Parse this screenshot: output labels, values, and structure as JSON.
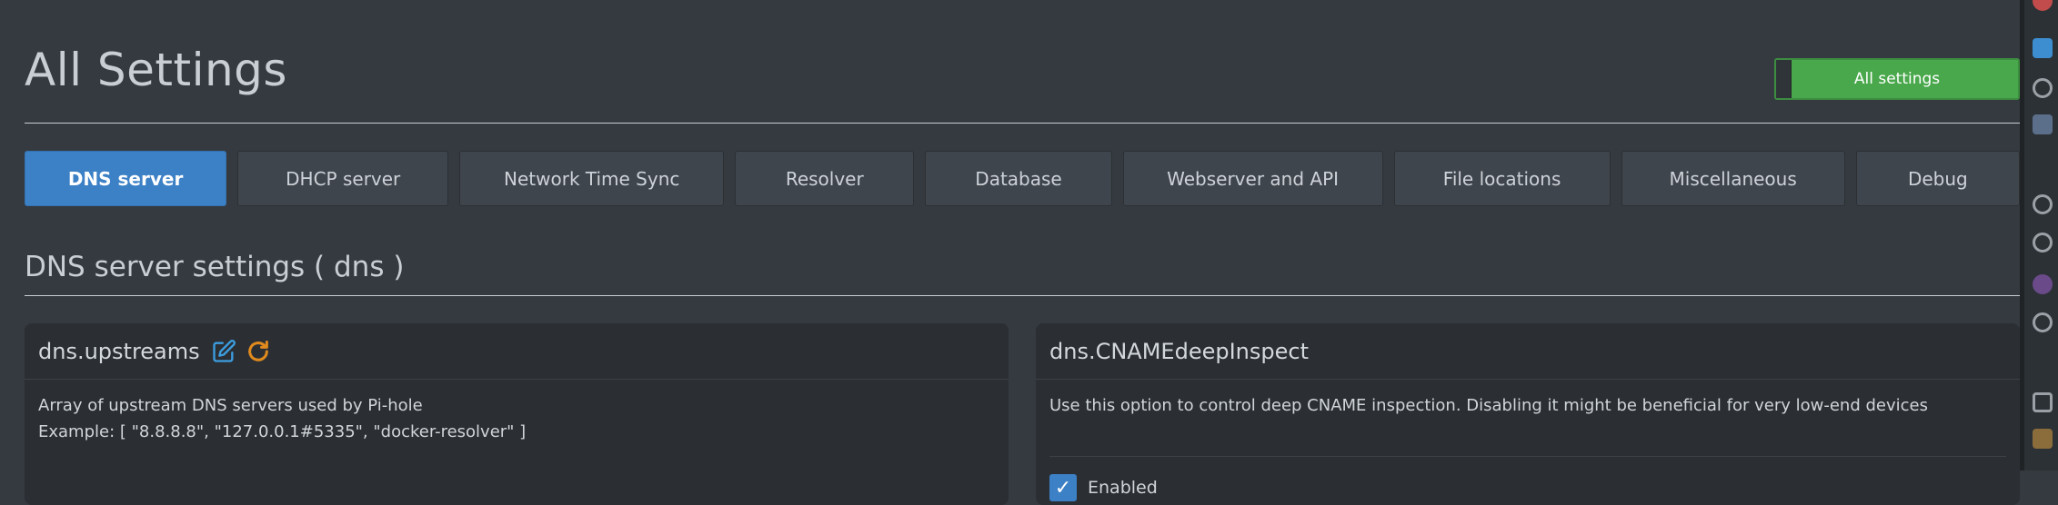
{
  "header": {
    "title": "All Settings",
    "mode_toggle_label": "All settings"
  },
  "tabs": [
    {
      "label": "DNS server",
      "active": true
    },
    {
      "label": "DHCP server",
      "active": false
    },
    {
      "label": "Network Time Sync",
      "active": false
    },
    {
      "label": "Resolver",
      "active": false
    },
    {
      "label": "Database",
      "active": false
    },
    {
      "label": "Webserver and API",
      "active": false
    },
    {
      "label": "File locations",
      "active": false
    },
    {
      "label": "Miscellaneous",
      "active": false
    },
    {
      "label": "Debug",
      "active": false
    }
  ],
  "section": {
    "heading": "DNS server settings ( dns )"
  },
  "cards": {
    "upstreams": {
      "title": "dns.upstreams",
      "edit_icon": "edit-icon",
      "reset_icon": "refresh-icon",
      "description_line1": "Array of upstream DNS servers used by Pi-hole",
      "description_line2": "Example: [ \"8.8.8.8\", \"127.0.0.1#5335\", \"docker-resolver\" ]"
    },
    "cname": {
      "title": "dns.CNAMEdeepInspect",
      "description": "Use this option to control deep CNAME inspection. Disabling it might be beneficial for very low-end devices",
      "checkbox_label": "Enabled",
      "checked": true
    }
  },
  "colors": {
    "background": "#353a40",
    "active_tab": "#3c80c6",
    "toggle_on": "#49a84b",
    "edit_icon": "#3c9ee0",
    "reset_icon": "#e08a1e"
  }
}
